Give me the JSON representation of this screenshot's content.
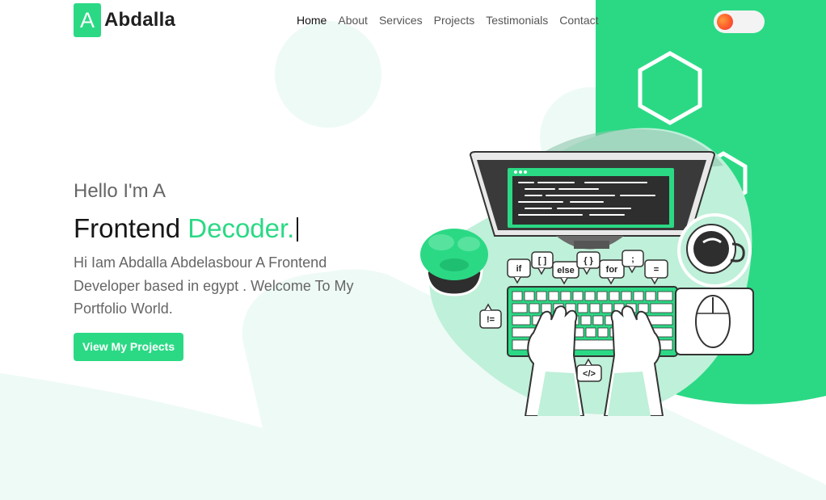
{
  "brand": {
    "badge_letter": "A",
    "name": "Abdalla"
  },
  "nav": {
    "links": [
      {
        "label": "Home",
        "active": true
      },
      {
        "label": "About",
        "active": false
      },
      {
        "label": "Services",
        "active": false
      },
      {
        "label": "Projects",
        "active": false
      },
      {
        "label": "Testimonials",
        "active": false
      },
      {
        "label": "Contact",
        "active": false
      }
    ]
  },
  "theme_toggle": {
    "state": "off",
    "icon": "sun-icon"
  },
  "hero": {
    "greeting": "Hello I'm A",
    "title_prefix": "Frontend",
    "title_accent": "Decoder.",
    "description": "Hi Iam Abdalla Abdelasbour A Frontend Developer based in egypt . Welcome To My Portfolio World.",
    "cta_label": "View My Projects"
  },
  "illustration": {
    "code_bubbles": [
      "if",
      "[ ]",
      "else",
      "{ }",
      "for",
      ";",
      "=",
      "!=",
      "</>"
    ],
    "icons": [
      "laptop-icon",
      "plant-icon",
      "coffee-cup-icon",
      "mouse-icon",
      "keyboard-icon",
      "hands-icon"
    ]
  },
  "colors": {
    "accent": "#2bd985",
    "accent_light": "#bff0d9",
    "tint": "#eefaf6",
    "text_dark": "#161616",
    "text_muted": "#666666"
  }
}
